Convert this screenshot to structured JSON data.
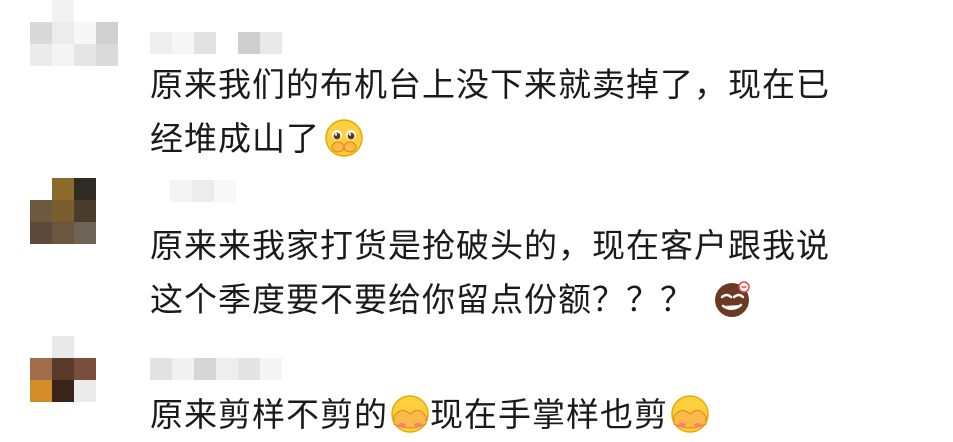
{
  "comments": [
    {
      "avatar_colors": [
        "#ffffff",
        "#f2f2f2",
        "#ffffff",
        "#ffffff",
        "#d9d9d9",
        "#ececec",
        "#f7f7f7",
        "#d0d0d0",
        "#ebebeb",
        "#f4f4f4",
        "#e6e6e6",
        "#dadada",
        "#ffffff",
        "#ffffff",
        "#ffffff",
        "#ffffff"
      ],
      "name_blur_colors": [
        "#eeeeee",
        "#f6f6f6",
        "#e2e2e2",
        "#ffffff",
        "#cfcfcf",
        "#e9e9e9"
      ],
      "lines": [
        "原来我们的布机台上没下来就卖掉了，现在已",
        "经堆成山了"
      ],
      "emoji": "pleading-face-icon"
    },
    {
      "avatar_colors": [
        "#ffffff",
        "#8c6a2b",
        "#2f2a22",
        "#ffffff",
        "#6c5a3f",
        "#7b5d2f",
        "#4a3b2a",
        "#ffffff",
        "#5b4a3b",
        "#6b563f",
        "#6e6355",
        "#ffffff",
        "#ffffff",
        "#ffffff",
        "#ffffff",
        "#ffffff"
      ],
      "name_blur_colors": [
        "#f4f4f4",
        "#ececec",
        "#f8f8f8"
      ],
      "lines": [
        "原来来我家打货是抢破头的，现在客户跟我说",
        "这个季度要不要给你留点份额？？？"
      ],
      "emoji": "smirk-face-icon"
    },
    {
      "avatar_colors": [
        "#ffffff",
        "#e9e9e9",
        "#ffffff",
        "#ffffff",
        "#a06c4a",
        "#5a3a2a",
        "#7a4e3c",
        "#ffffff",
        "#d48b2a",
        "#3a2418",
        "#eaeaea",
        "#ffffff",
        "#ffffff",
        "#ffffff",
        "#ffffff",
        "#ffffff"
      ],
      "name_blur_colors": [
        "#e2e2e2",
        "#f1f1f1",
        "#d6d6d6",
        "#eeeeee",
        "#e4e4e4",
        "#f5f5f5"
      ],
      "segments": [
        {
          "text": "原来剪样不剪的",
          "emoji": "facepalm-face-icon"
        },
        {
          "text": "现在手掌样也剪",
          "emoji": "facepalm-face-icon"
        }
      ]
    }
  ]
}
